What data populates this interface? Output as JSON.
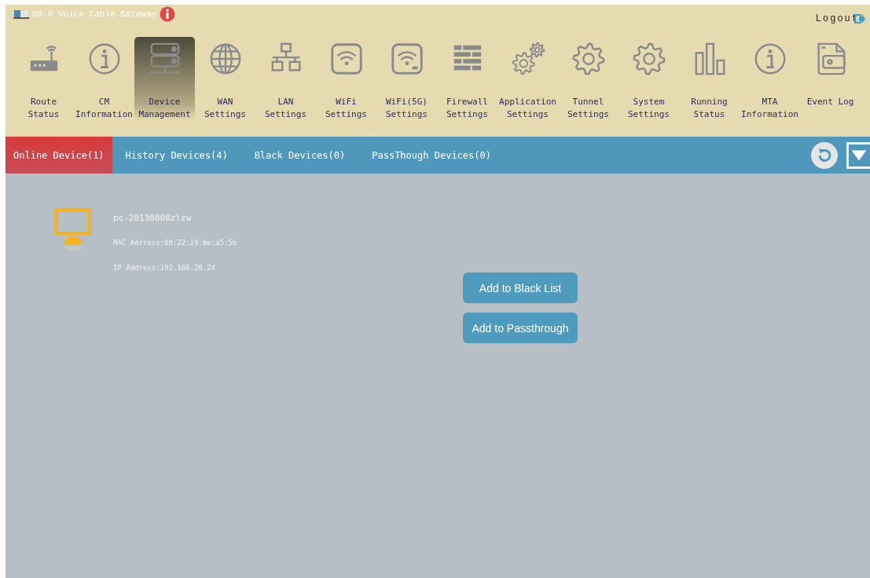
{
  "header": {
    "title": "D3.0 Voice Cable Gateway",
    "logout": "Logout"
  },
  "nav": [
    {
      "lines": [
        "Route",
        "Status"
      ],
      "selected": false
    },
    {
      "lines": [
        "CM",
        "Information"
      ],
      "selected": false
    },
    {
      "lines": [
        "Device",
        "Management"
      ],
      "selected": true
    },
    {
      "lines": [
        "WAN",
        "Settings"
      ],
      "selected": false
    },
    {
      "lines": [
        "LAN",
        "Settings"
      ],
      "selected": false
    },
    {
      "lines": [
        "WiFi",
        "Settings"
      ],
      "selected": false
    },
    {
      "lines": [
        "WiFi(5G)",
        "Settings"
      ],
      "selected": false
    },
    {
      "lines": [
        "Firewall",
        "Settings"
      ],
      "selected": false
    },
    {
      "lines": [
        "Application",
        "Settings"
      ],
      "selected": false
    },
    {
      "lines": [
        "Tunnel",
        "Settings"
      ],
      "selected": false
    },
    {
      "lines": [
        "System",
        "Settings"
      ],
      "selected": false
    },
    {
      "lines": [
        "Running",
        "Status"
      ],
      "selected": false
    },
    {
      "lines": [
        "MTA",
        "Information"
      ],
      "selected": false
    },
    {
      "lines": [
        "Event Log"
      ],
      "selected": false
    }
  ],
  "tabs": [
    {
      "label": "Online Device(1)",
      "selected": true
    },
    {
      "label": "History Devices(4)",
      "selected": false
    },
    {
      "label": "Black Devices(0)",
      "selected": false
    },
    {
      "label": "PassThough Devices(0)",
      "selected": false
    }
  ],
  "devices": [
    {
      "name": "pc-20130808zlzw",
      "mac": "MAC Adrress:00:22:19:0e:a5:5b",
      "ip": "IP Address:192.168.20.24"
    }
  ],
  "buttons": [
    "Add to Black List",
    "Add to Passthrough"
  ]
}
